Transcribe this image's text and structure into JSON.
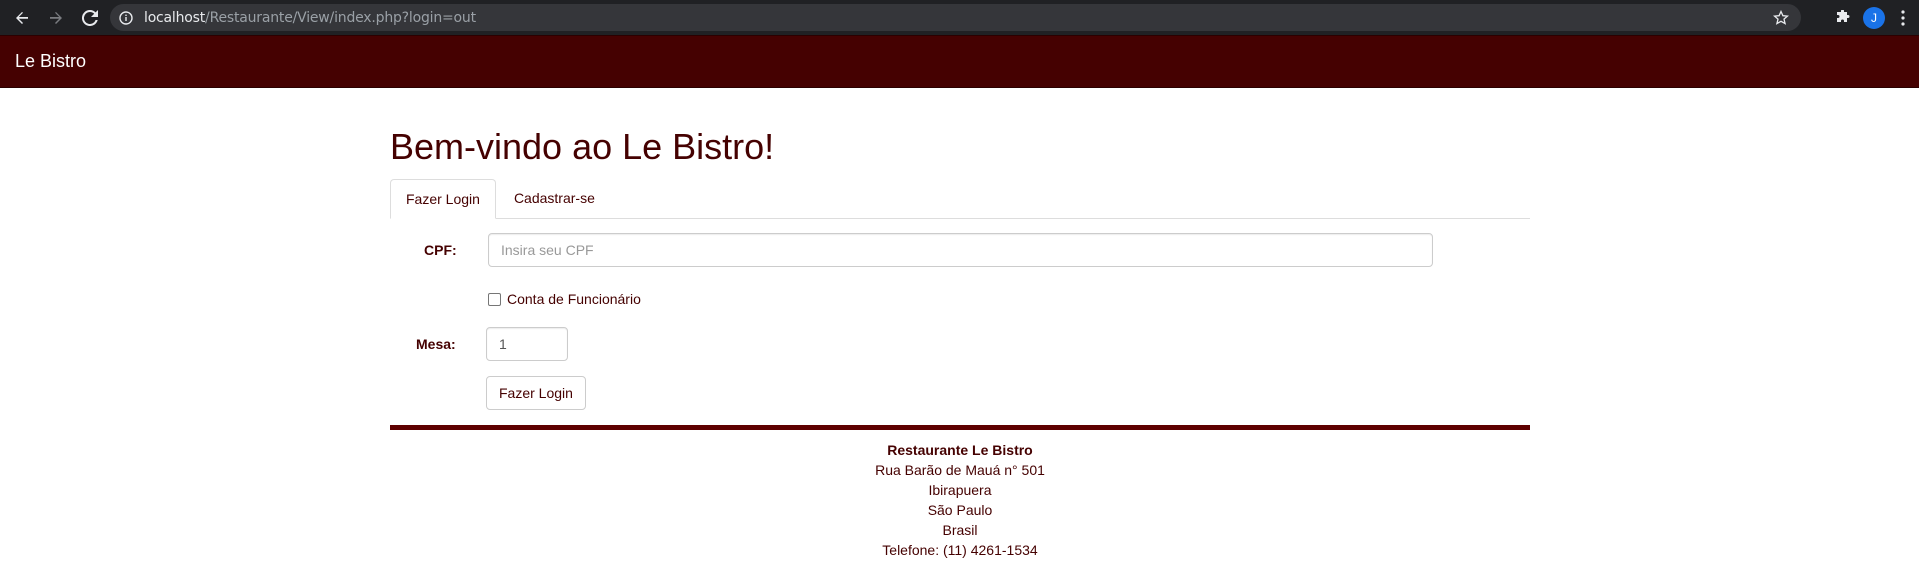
{
  "browser": {
    "url_host": "localhost",
    "url_path": "/Restaurante/View/index.php?login=out",
    "profile_initial": "J"
  },
  "navbar": {
    "brand": "Le Bistro"
  },
  "main": {
    "title": "Bem-vindo ao Le Bistro!",
    "tabs": [
      {
        "label": "Fazer Login",
        "active": true
      },
      {
        "label": "Cadastrar-se",
        "active": false
      }
    ],
    "form": {
      "cpf_label": "CPF:",
      "cpf_placeholder": "Insira seu CPF",
      "employee_checkbox_label": "Conta de Funcionário",
      "table_label": "Mesa:",
      "table_value": "1",
      "submit_label": "Fazer Login"
    }
  },
  "footer": {
    "name": "Restaurante Le Bistro",
    "address_line": "Rua Barão de Mauá n° 501",
    "district": "Ibirapuera",
    "city": "São Paulo",
    "country": "Brasil",
    "phone": "Telefone: (11) 4261-1534"
  },
  "colors": {
    "brand": "#450101",
    "footer_rule": "#5e0000"
  }
}
